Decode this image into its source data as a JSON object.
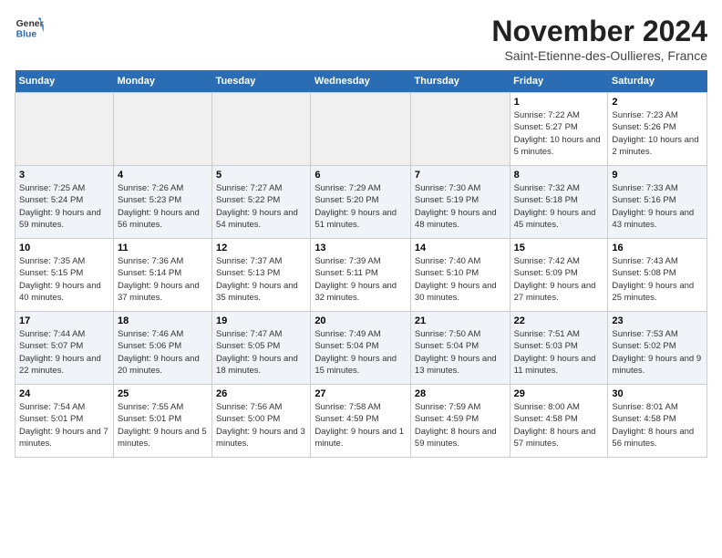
{
  "header": {
    "logo_line1": "General",
    "logo_line2": "Blue",
    "month": "November 2024",
    "location": "Saint-Etienne-des-Oullieres, France"
  },
  "days_of_week": [
    "Sunday",
    "Monday",
    "Tuesday",
    "Wednesday",
    "Thursday",
    "Friday",
    "Saturday"
  ],
  "weeks": [
    [
      {
        "day": "",
        "info": ""
      },
      {
        "day": "",
        "info": ""
      },
      {
        "day": "",
        "info": ""
      },
      {
        "day": "",
        "info": ""
      },
      {
        "day": "",
        "info": ""
      },
      {
        "day": "1",
        "info": "Sunrise: 7:22 AM\nSunset: 5:27 PM\nDaylight: 10 hours and 5 minutes."
      },
      {
        "day": "2",
        "info": "Sunrise: 7:23 AM\nSunset: 5:26 PM\nDaylight: 10 hours and 2 minutes."
      }
    ],
    [
      {
        "day": "3",
        "info": "Sunrise: 7:25 AM\nSunset: 5:24 PM\nDaylight: 9 hours and 59 minutes."
      },
      {
        "day": "4",
        "info": "Sunrise: 7:26 AM\nSunset: 5:23 PM\nDaylight: 9 hours and 56 minutes."
      },
      {
        "day": "5",
        "info": "Sunrise: 7:27 AM\nSunset: 5:22 PM\nDaylight: 9 hours and 54 minutes."
      },
      {
        "day": "6",
        "info": "Sunrise: 7:29 AM\nSunset: 5:20 PM\nDaylight: 9 hours and 51 minutes."
      },
      {
        "day": "7",
        "info": "Sunrise: 7:30 AM\nSunset: 5:19 PM\nDaylight: 9 hours and 48 minutes."
      },
      {
        "day": "8",
        "info": "Sunrise: 7:32 AM\nSunset: 5:18 PM\nDaylight: 9 hours and 45 minutes."
      },
      {
        "day": "9",
        "info": "Sunrise: 7:33 AM\nSunset: 5:16 PM\nDaylight: 9 hours and 43 minutes."
      }
    ],
    [
      {
        "day": "10",
        "info": "Sunrise: 7:35 AM\nSunset: 5:15 PM\nDaylight: 9 hours and 40 minutes."
      },
      {
        "day": "11",
        "info": "Sunrise: 7:36 AM\nSunset: 5:14 PM\nDaylight: 9 hours and 37 minutes."
      },
      {
        "day": "12",
        "info": "Sunrise: 7:37 AM\nSunset: 5:13 PM\nDaylight: 9 hours and 35 minutes."
      },
      {
        "day": "13",
        "info": "Sunrise: 7:39 AM\nSunset: 5:11 PM\nDaylight: 9 hours and 32 minutes."
      },
      {
        "day": "14",
        "info": "Sunrise: 7:40 AM\nSunset: 5:10 PM\nDaylight: 9 hours and 30 minutes."
      },
      {
        "day": "15",
        "info": "Sunrise: 7:42 AM\nSunset: 5:09 PM\nDaylight: 9 hours and 27 minutes."
      },
      {
        "day": "16",
        "info": "Sunrise: 7:43 AM\nSunset: 5:08 PM\nDaylight: 9 hours and 25 minutes."
      }
    ],
    [
      {
        "day": "17",
        "info": "Sunrise: 7:44 AM\nSunset: 5:07 PM\nDaylight: 9 hours and 22 minutes."
      },
      {
        "day": "18",
        "info": "Sunrise: 7:46 AM\nSunset: 5:06 PM\nDaylight: 9 hours and 20 minutes."
      },
      {
        "day": "19",
        "info": "Sunrise: 7:47 AM\nSunset: 5:05 PM\nDaylight: 9 hours and 18 minutes."
      },
      {
        "day": "20",
        "info": "Sunrise: 7:49 AM\nSunset: 5:04 PM\nDaylight: 9 hours and 15 minutes."
      },
      {
        "day": "21",
        "info": "Sunrise: 7:50 AM\nSunset: 5:04 PM\nDaylight: 9 hours and 13 minutes."
      },
      {
        "day": "22",
        "info": "Sunrise: 7:51 AM\nSunset: 5:03 PM\nDaylight: 9 hours and 11 minutes."
      },
      {
        "day": "23",
        "info": "Sunrise: 7:53 AM\nSunset: 5:02 PM\nDaylight: 9 hours and 9 minutes."
      }
    ],
    [
      {
        "day": "24",
        "info": "Sunrise: 7:54 AM\nSunset: 5:01 PM\nDaylight: 9 hours and 7 minutes."
      },
      {
        "day": "25",
        "info": "Sunrise: 7:55 AM\nSunset: 5:01 PM\nDaylight: 9 hours and 5 minutes."
      },
      {
        "day": "26",
        "info": "Sunrise: 7:56 AM\nSunset: 5:00 PM\nDaylight: 9 hours and 3 minutes."
      },
      {
        "day": "27",
        "info": "Sunrise: 7:58 AM\nSunset: 4:59 PM\nDaylight: 9 hours and 1 minute."
      },
      {
        "day": "28",
        "info": "Sunrise: 7:59 AM\nSunset: 4:59 PM\nDaylight: 8 hours and 59 minutes."
      },
      {
        "day": "29",
        "info": "Sunrise: 8:00 AM\nSunset: 4:58 PM\nDaylight: 8 hours and 57 minutes."
      },
      {
        "day": "30",
        "info": "Sunrise: 8:01 AM\nSunset: 4:58 PM\nDaylight: 8 hours and 56 minutes."
      }
    ]
  ]
}
